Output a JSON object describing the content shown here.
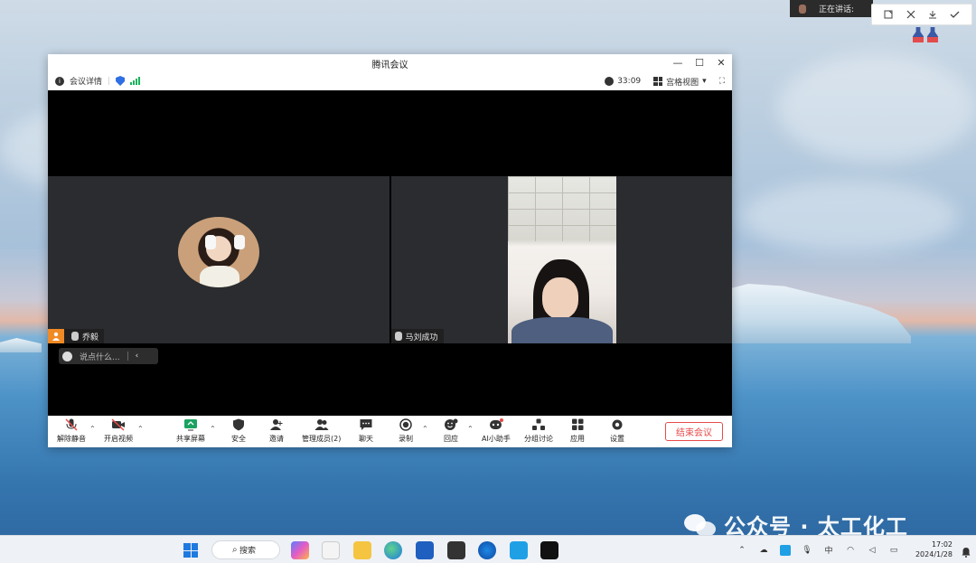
{
  "desktop": {
    "speaking_label": "正在讲话:",
    "watermark_text": "公众号 · 太工化工"
  },
  "window": {
    "title": "腾讯会议",
    "info": {
      "meeting_details": "会议详情",
      "duration": "33:09",
      "layout_label": "宫格视图"
    },
    "participants": [
      {
        "name": "乔毅",
        "is_host": true
      },
      {
        "name": "马刘成功",
        "is_host": false
      }
    ],
    "chat_placeholder": "说点什么..."
  },
  "toolbar": {
    "unmute": "解除静音",
    "start_video": "开启视频",
    "share_screen": "共享屏幕",
    "security": "安全",
    "invite": "邀请",
    "participants": "管理成员(2)",
    "chat": "聊天",
    "record": "录制",
    "reactions": "回应",
    "ai_assistant": "AI小助手",
    "breakout": "分组讨论",
    "apps": "应用",
    "settings": "设置",
    "end_meeting": "结束会议"
  },
  "taskbar": {
    "search_label": "搜索",
    "ime": "中",
    "time": "17:02",
    "date": "2024/1/28"
  },
  "colors": {
    "accent_blue": "#2f6fe4",
    "end_red": "#e84a4a",
    "host_orange": "#f08a24",
    "signal_green": "#19b35a"
  }
}
